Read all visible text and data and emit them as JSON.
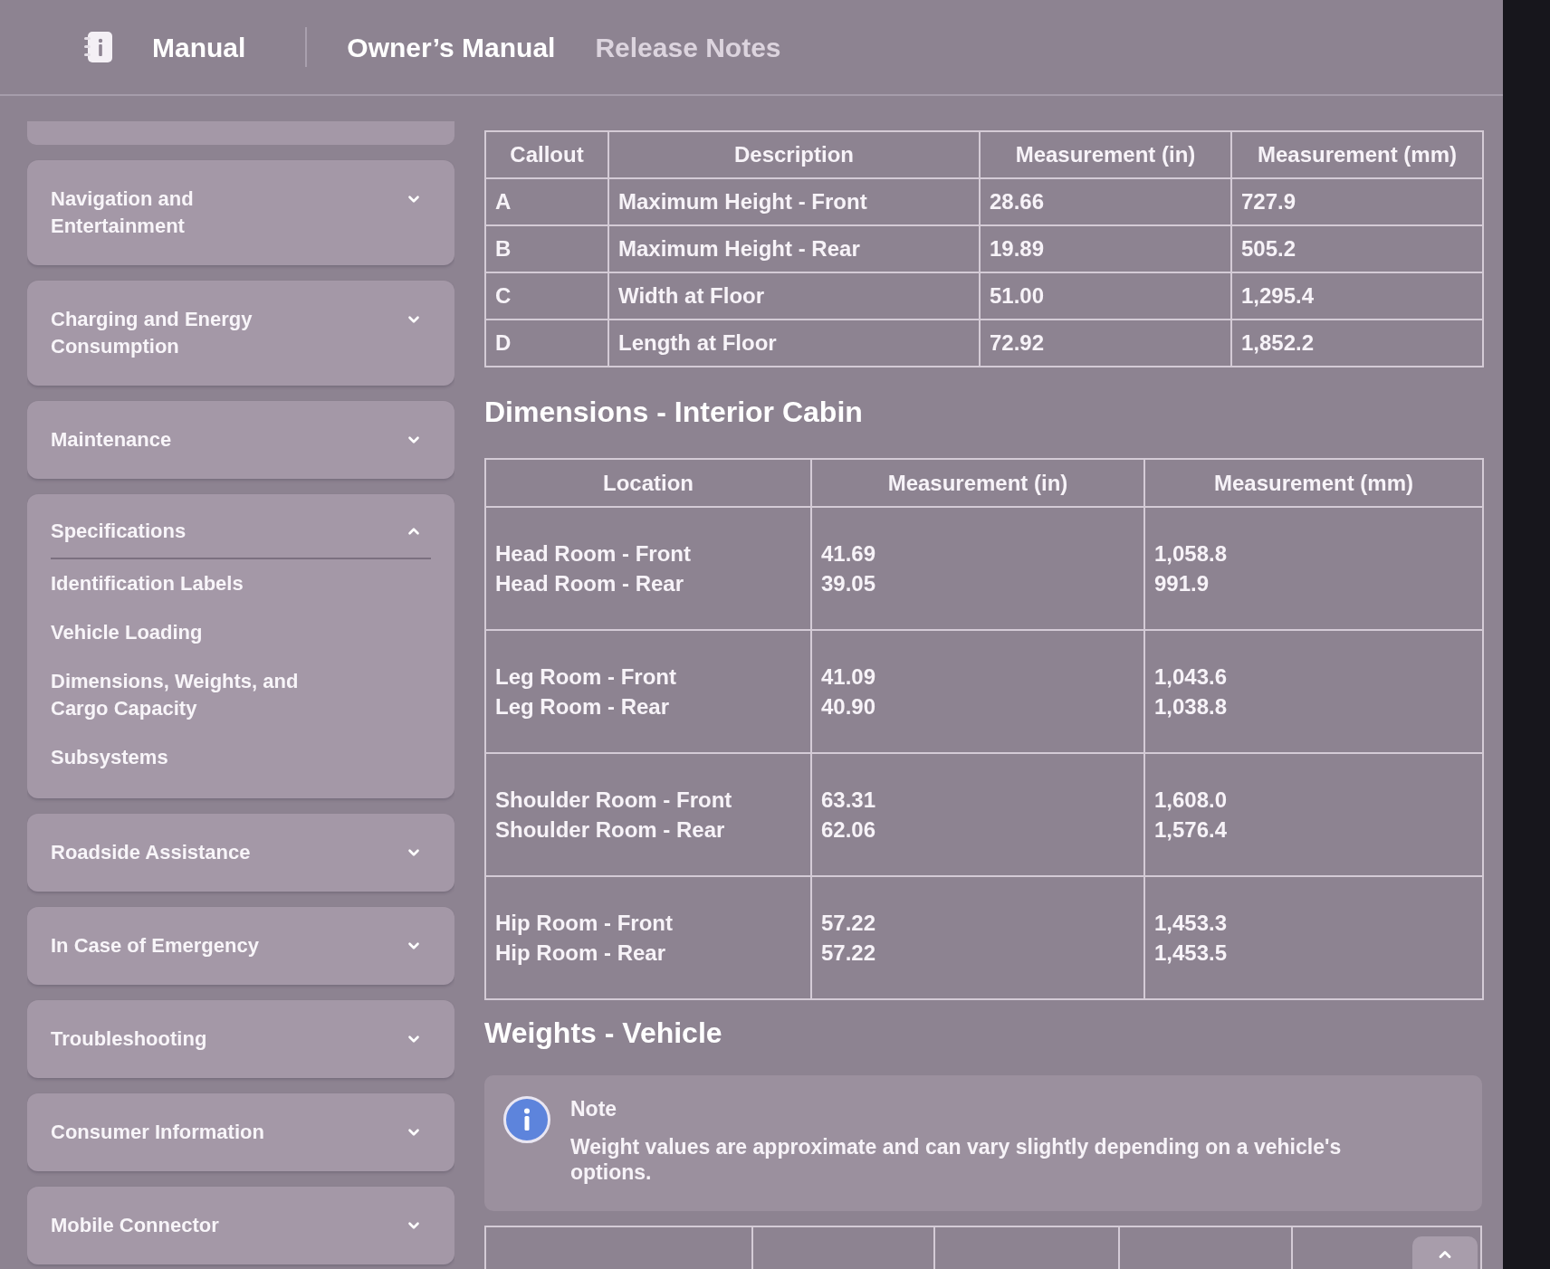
{
  "header": {
    "title": "Manual",
    "tabs": [
      {
        "label": "Owner’s Manual",
        "selected": true
      },
      {
        "label": "Release Notes",
        "selected": false
      }
    ]
  },
  "sidebar": {
    "items": [
      {
        "label": "Navigation and Entertainment",
        "expanded": false
      },
      {
        "label": "Charging and Energy Consumption",
        "expanded": false
      },
      {
        "label": "Maintenance",
        "expanded": false
      },
      {
        "label": "Specifications",
        "expanded": true,
        "children": [
          {
            "label": "Identification Labels"
          },
          {
            "label": "Vehicle Loading"
          },
          {
            "label": "Dimensions, Weights, and Cargo Capacity"
          },
          {
            "label": "Subsystems"
          }
        ]
      },
      {
        "label": "Roadside Assistance",
        "expanded": false
      },
      {
        "label": "In Case of Emergency",
        "expanded": false
      },
      {
        "label": "Troubleshooting",
        "expanded": false
      },
      {
        "label": "Consumer Information",
        "expanded": false
      },
      {
        "label": "Mobile Connector",
        "expanded": false
      }
    ]
  },
  "content": {
    "callout_table": {
      "columns": [
        "Callout",
        "Description",
        "Measurement (in)",
        "Measurement (mm)"
      ],
      "rows": [
        [
          "A",
          "Maximum Height - Front",
          "28.66",
          "727.9"
        ],
        [
          "B",
          "Maximum Height - Rear",
          "19.89",
          "505.2"
        ],
        [
          "C",
          "Width at Floor",
          "51.00",
          "1,295.4"
        ],
        [
          "D",
          "Length at Floor",
          "72.92",
          "1,852.2"
        ]
      ]
    },
    "interior_section": {
      "heading": "Dimensions - Interior Cabin",
      "table": {
        "columns": [
          "Location",
          "Measurement (in)",
          "Measurement (mm)"
        ],
        "rows": [
          [
            [
              "Head Room - Front",
              "Head Room - Rear"
            ],
            [
              "41.69",
              "39.05"
            ],
            [
              "1,058.8",
              "991.9"
            ]
          ],
          [
            [
              "Leg Room - Front",
              "Leg Room - Rear"
            ],
            [
              "41.09",
              "40.90"
            ],
            [
              "1,043.6",
              "1,038.8"
            ]
          ],
          [
            [
              "Shoulder Room - Front",
              "Shoulder Room - Rear"
            ],
            [
              "63.31",
              "62.06"
            ],
            [
              "1,608.0",
              "1,576.4"
            ]
          ],
          [
            [
              "Hip Room - Front",
              "Hip Room - Rear"
            ],
            [
              "57.22",
              "57.22"
            ],
            [
              "1,453.3",
              "1,453.5"
            ]
          ]
        ]
      }
    },
    "weights_section": {
      "heading": "Weights - Vehicle",
      "note": {
        "title": "Note",
        "text": "Weight values are approximate and can vary slightly depending on a vehicle's options."
      }
    }
  }
}
